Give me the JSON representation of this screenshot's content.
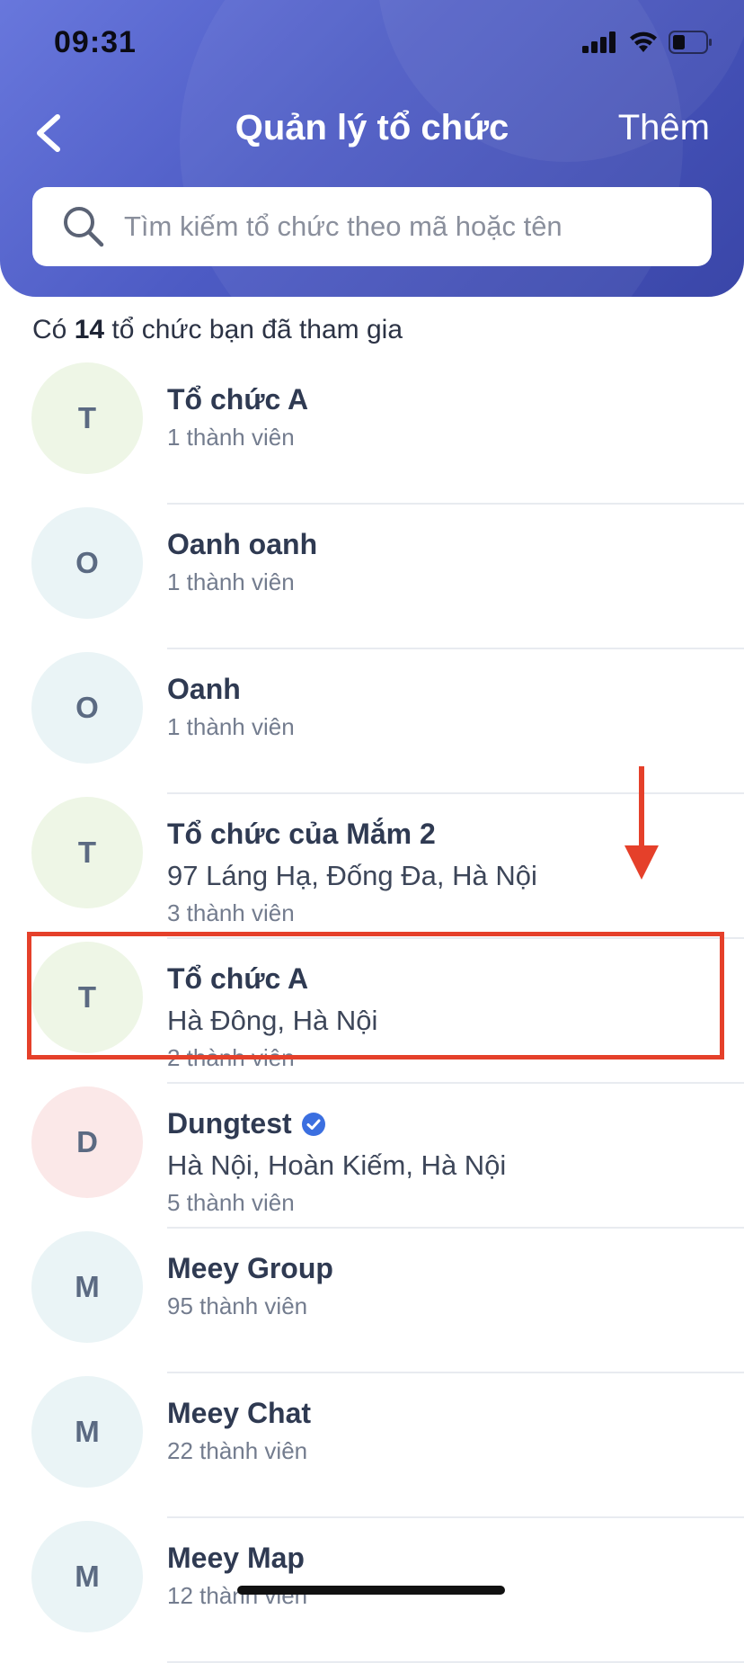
{
  "status_bar": {
    "time": "09:31"
  },
  "header": {
    "title": "Quản lý tổ chức",
    "add_label": "Thêm",
    "search_placeholder": "Tìm kiếm tổ chức theo mã hoặc tên"
  },
  "summary": {
    "prefix": "Có",
    "count": "14",
    "suffix": "tổ chức bạn đã tham gia"
  },
  "organizations": [
    {
      "initial": "T",
      "name": "Tổ chức A",
      "address": "",
      "members": "1 thành viên",
      "avatar_color": "#eef6e6",
      "verified": false
    },
    {
      "initial": "O",
      "name": "Oanh oanh",
      "address": "",
      "members": "1 thành viên",
      "avatar_color": "#eaf4f6",
      "verified": false
    },
    {
      "initial": "O",
      "name": "Oanh",
      "address": "",
      "members": "1 thành viên",
      "avatar_color": "#eaf4f6",
      "verified": false
    },
    {
      "initial": "T",
      "name": "Tổ chức của Mắm 2",
      "address": "97 Láng Hạ, Đống Đa, Hà Nội",
      "members": "3 thành viên",
      "avatar_color": "#eef6e6",
      "verified": false
    },
    {
      "initial": "T",
      "name": "Tổ chức A",
      "address": "Hà Đông, Hà Nội",
      "members": "2 thành viên",
      "avatar_color": "#eef6e6",
      "verified": false
    },
    {
      "initial": "D",
      "name": "Dungtest",
      "address": "Hà Nội, Hoàn Kiếm, Hà Nội",
      "members": "5 thành viên",
      "avatar_color": "#fbe8e8",
      "verified": true
    },
    {
      "initial": "M",
      "name": "Meey Group",
      "address": "",
      "members": "95 thành viên",
      "avatar_color": "#eaf4f6",
      "verified": false
    },
    {
      "initial": "M",
      "name": "Meey Chat",
      "address": "",
      "members": "22 thành viên",
      "avatar_color": "#eaf4f6",
      "verified": false
    },
    {
      "initial": "M",
      "name": "Meey Map",
      "address": "",
      "members": "12 thành viên",
      "avatar_color": "#eaf4f6",
      "verified": false
    }
  ],
  "colors": {
    "header_gradient_start": "#6877dc",
    "header_gradient_end": "#3a46a8",
    "annotation_red": "#e5402a",
    "verified_blue": "#3b6fe0"
  }
}
